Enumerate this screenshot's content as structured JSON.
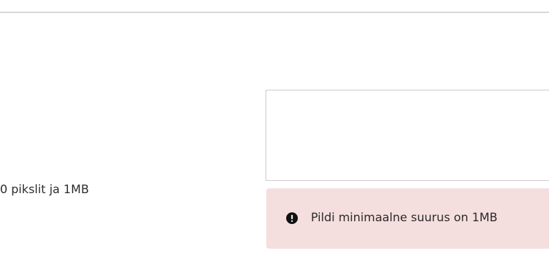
{
  "image_field": {
    "hint_text": "0 pikslit ja 1MB"
  },
  "alert": {
    "message": "Pildi minimaalne suurus on 1MB",
    "icon": "exclamation-circle-icon",
    "background_color": "#f5dede"
  }
}
